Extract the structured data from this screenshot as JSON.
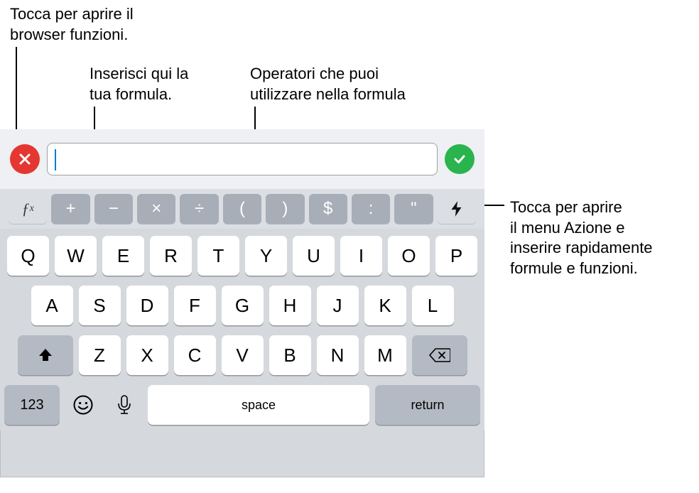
{
  "callouts": {
    "functions_browser": "Tocca per aprire il\nbrowser funzioni.",
    "formula_input": "Inserisci qui la\ntua formula.",
    "operators": "Operatori che puoi\nutilizzare nella formula",
    "action_menu": "Tocca per aprire\nil menu Azione e\ninserire rapidamente\nformule e funzioni."
  },
  "formula_bar": {
    "value": "",
    "fx_label": "ƒx"
  },
  "operators": [
    "+",
    "−",
    "×",
    "÷",
    "(",
    ")",
    "$",
    ":",
    "\""
  ],
  "keyboard": {
    "row1": [
      "Q",
      "W",
      "E",
      "R",
      "T",
      "Y",
      "U",
      "I",
      "O",
      "P"
    ],
    "row2": [
      "A",
      "S",
      "D",
      "F",
      "G",
      "H",
      "J",
      "K",
      "L"
    ],
    "row3": [
      "Z",
      "X",
      "C",
      "V",
      "B",
      "N",
      "M"
    ],
    "numeric": "123",
    "space": "space",
    "return": "return"
  }
}
